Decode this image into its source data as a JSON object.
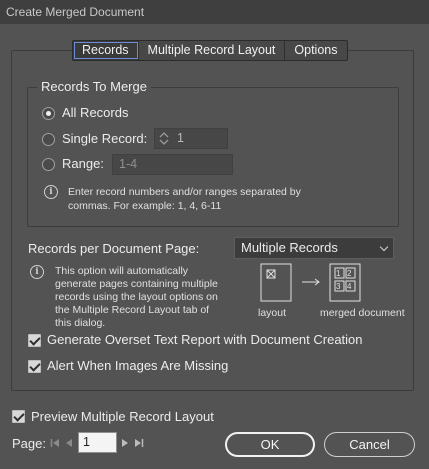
{
  "window": {
    "title": "Create Merged Document"
  },
  "tabs": [
    {
      "label": "Records",
      "active": true
    },
    {
      "label": "Multiple Record Layout",
      "active": false
    },
    {
      "label": "Options",
      "active": false
    }
  ],
  "records_to_merge": {
    "title": "Records To Merge",
    "all_records": {
      "label": "All Records",
      "selected": true
    },
    "single_record": {
      "label": "Single Record:",
      "value": "1",
      "selected": false
    },
    "range": {
      "label": "Range:",
      "placeholder": "1-4",
      "selected": false
    },
    "hint_line1": "Enter record numbers and/or ranges separated by",
    "hint_line2": "commas. For example: 1, 4, 6-11"
  },
  "records_per_page": {
    "label": "Records per Document Page:",
    "selected": "Multiple Records",
    "info_lines": [
      "This option will automatically",
      "generate pages containing multiple",
      "records using the layout options on",
      "the Multiple Record Layout tab of",
      "this dialog."
    ],
    "diagram": {
      "layout_label": "layout",
      "merged_label": "merged document",
      "cells": [
        "1",
        "2",
        "3",
        "4"
      ]
    }
  },
  "options": {
    "overset": {
      "label": "Generate Overset Text Report with Document Creation",
      "checked": true
    },
    "missing_images": {
      "label": "Alert When Images Are Missing",
      "checked": true
    }
  },
  "preview": {
    "label": "Preview Multiple Record Layout",
    "checked": true
  },
  "page": {
    "label": "Page:",
    "value": "1"
  },
  "buttons": {
    "ok": "OK",
    "cancel": "Cancel"
  },
  "colors": {
    "background": "#535353",
    "titlebar": "#3f3f3f",
    "tab_focus": "#6b8fd6"
  },
  "icons": [
    "info-icon",
    "chevron-down-icon",
    "spinner-icon",
    "first-page-icon",
    "prev-page-icon",
    "next-page-icon",
    "last-page-icon"
  ]
}
